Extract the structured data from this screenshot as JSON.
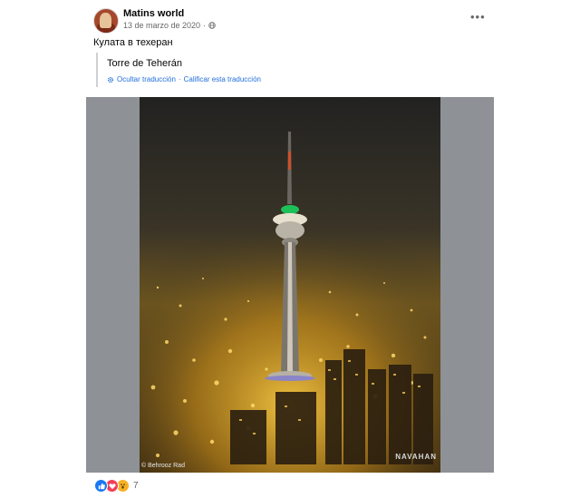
{
  "post": {
    "author": "Matins world",
    "date": "13 de marzo de 2020",
    "privacy_icon": "globe-icon",
    "text": "Кулата в техеран",
    "translation": "Torre de Teherán",
    "hide_translation": "Ocultar traducción",
    "separator": "·",
    "rate_translation": "Calificar esta traducción"
  },
  "photo": {
    "credit": "© Behrooz Rad",
    "watermark": "NAVAHAN"
  },
  "reactions": {
    "types": [
      "like-icon",
      "love-icon",
      "wow-icon"
    ],
    "count": "7"
  },
  "colors": {
    "link": "#216fdb",
    "secondary_text": "#65676b",
    "like": "#1877f2",
    "love": "#f33e58",
    "wow": "#f7b125"
  }
}
